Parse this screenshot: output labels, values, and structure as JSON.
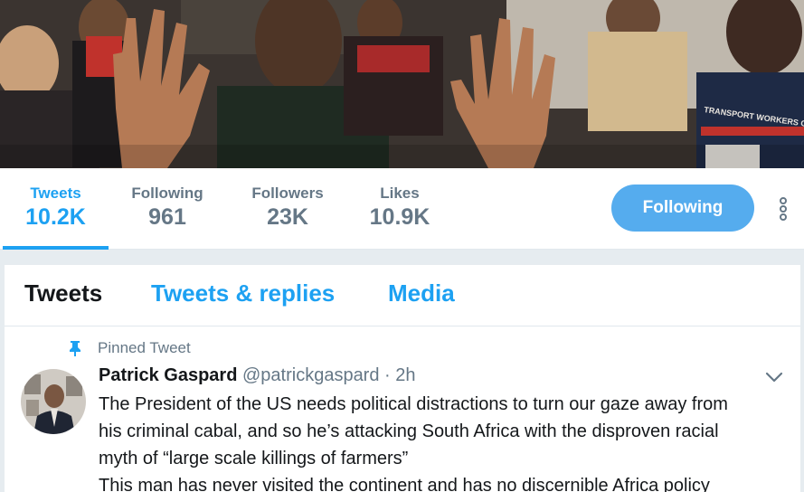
{
  "profile_nav": {
    "stats": [
      {
        "label": "Tweets",
        "value": "10.2K"
      },
      {
        "label": "Following",
        "value": "961"
      },
      {
        "label": "Followers",
        "value": "23K"
      },
      {
        "label": "Likes",
        "value": "10.9K"
      }
    ],
    "follow_button_label": "Following",
    "more_icon": "vertical-ellipsis-icon"
  },
  "timeline": {
    "tabs": [
      "Tweets",
      "Tweets & replies",
      "Media"
    ],
    "active_tab": "Tweets"
  },
  "pinned_tweet": {
    "pinned_label": "Pinned Tweet",
    "author_name": "Patrick Gaspard",
    "handle": "@patrickgaspard",
    "separator": "·",
    "time": "2h",
    "text_lines": [
      "The President of the US needs political distractions to turn our gaze away from",
      "his criminal cabal, and so he’s attacking South Africa with the disproven racial",
      "myth of “large scale killings of farmers”",
      "This man has never visited the continent and has no discernible Africa policy"
    ]
  },
  "banner_image_text": "TRANSPORT WORKERS OF AMERICA · AFL-CIO",
  "colors": {
    "accent": "#1da1f2",
    "follow_button": "#55acee",
    "secondary_text": "#657786",
    "primary_text": "#14171a",
    "page_background": "#e6ecf0"
  }
}
